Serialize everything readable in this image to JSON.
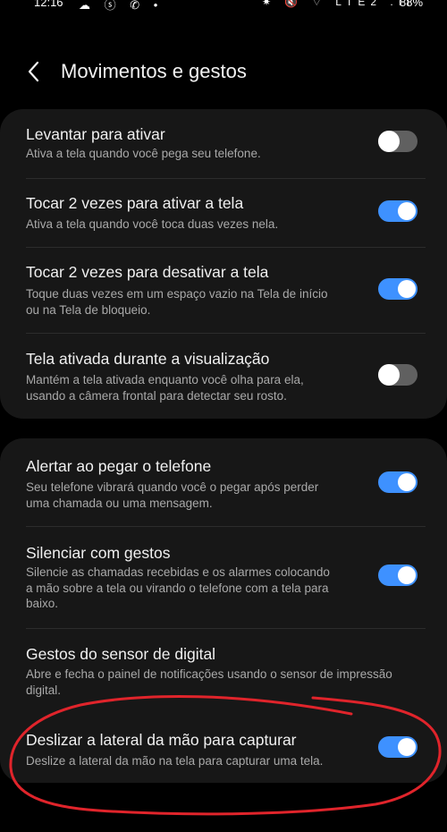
{
  "status_bar": {
    "time": "12:16",
    "left_icons": "☁ ⓢ ✆ •",
    "right_icons": "✷ 🔇 ⌔ LTE2 .ıl",
    "battery": "88%"
  },
  "header": {
    "title": "Movimentos e gestos"
  },
  "group1": {
    "items": [
      {
        "title": "Levantar para ativar",
        "desc": "Ativa a tela quando você pega seu telefone.",
        "enabled": false
      },
      {
        "title": "Tocar 2 vezes para ativar a tela",
        "desc": "Ativa a tela quando você toca duas vezes nela.",
        "enabled": true
      },
      {
        "title": "Tocar 2 vezes para desativar a tela",
        "desc_lines": [
          "Toque duas vezes em um espaço vazio na Tela de início",
          "ou na Tela de bloqueio."
        ],
        "enabled": true
      },
      {
        "title": "Tela ativada durante a visualização",
        "desc_lines": [
          "Mantém a tela ativada enquanto você olha para ela,",
          "usando a câmera frontal para detectar seu rosto."
        ],
        "enabled": false
      }
    ]
  },
  "group2": {
    "items": [
      {
        "title": "Alertar ao pegar o telefone",
        "desc_lines": [
          "Seu telefone vibrará quando você o pegar após perder",
          "uma chamada ou uma mensagem."
        ],
        "enabled": true
      },
      {
        "title": "Silenciar com gestos",
        "desc_lines": [
          "Silencie as chamadas recebidas e os alarmes colocando",
          "a mão sobre a tela ou virando o telefone com a tela para",
          "baixo."
        ],
        "enabled": true
      },
      {
        "title": "Gestos do sensor de digital",
        "desc_lines": [
          "Abre e fecha o painel de notificações usando o sensor de impressão",
          "digital."
        ]
      },
      {
        "title": "Deslizar a lateral da mão para capturar",
        "desc": "Deslize a lateral da mão na tela para capturar uma tela.",
        "enabled": true
      }
    ]
  },
  "colors": {
    "background": "#000000",
    "card": "#171717",
    "toggle_on": "#3e91ff",
    "toggle_off": "#606060",
    "annotation": "#e0242b"
  }
}
